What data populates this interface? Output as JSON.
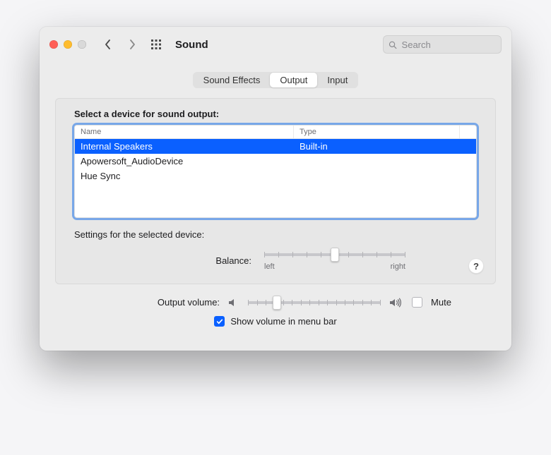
{
  "window": {
    "title": "Sound"
  },
  "search": {
    "placeholder": "Search"
  },
  "tabs": {
    "sound_effects": "Sound Effects",
    "output": "Output",
    "input": "Input",
    "selected": "output"
  },
  "output": {
    "heading": "Select a device for sound output:",
    "columns": {
      "name": "Name",
      "type": "Type"
    },
    "devices": [
      {
        "name": "Internal Speakers",
        "type": "Built-in",
        "selected": true
      },
      {
        "name": "Apowersoft_AudioDevice",
        "type": "",
        "selected": false
      },
      {
        "name": "Hue Sync",
        "type": "",
        "selected": false
      }
    ],
    "settings_label": "Settings for the selected device:",
    "balance": {
      "label": "Balance:",
      "left_label": "left",
      "right_label": "right",
      "value": 0.5
    }
  },
  "help": {
    "label": "?"
  },
  "volume": {
    "label": "Output volume:",
    "value": 0.22,
    "mute_label": "Mute",
    "mute_checked": false
  },
  "menubar": {
    "label": "Show volume in menu bar",
    "checked": true
  }
}
